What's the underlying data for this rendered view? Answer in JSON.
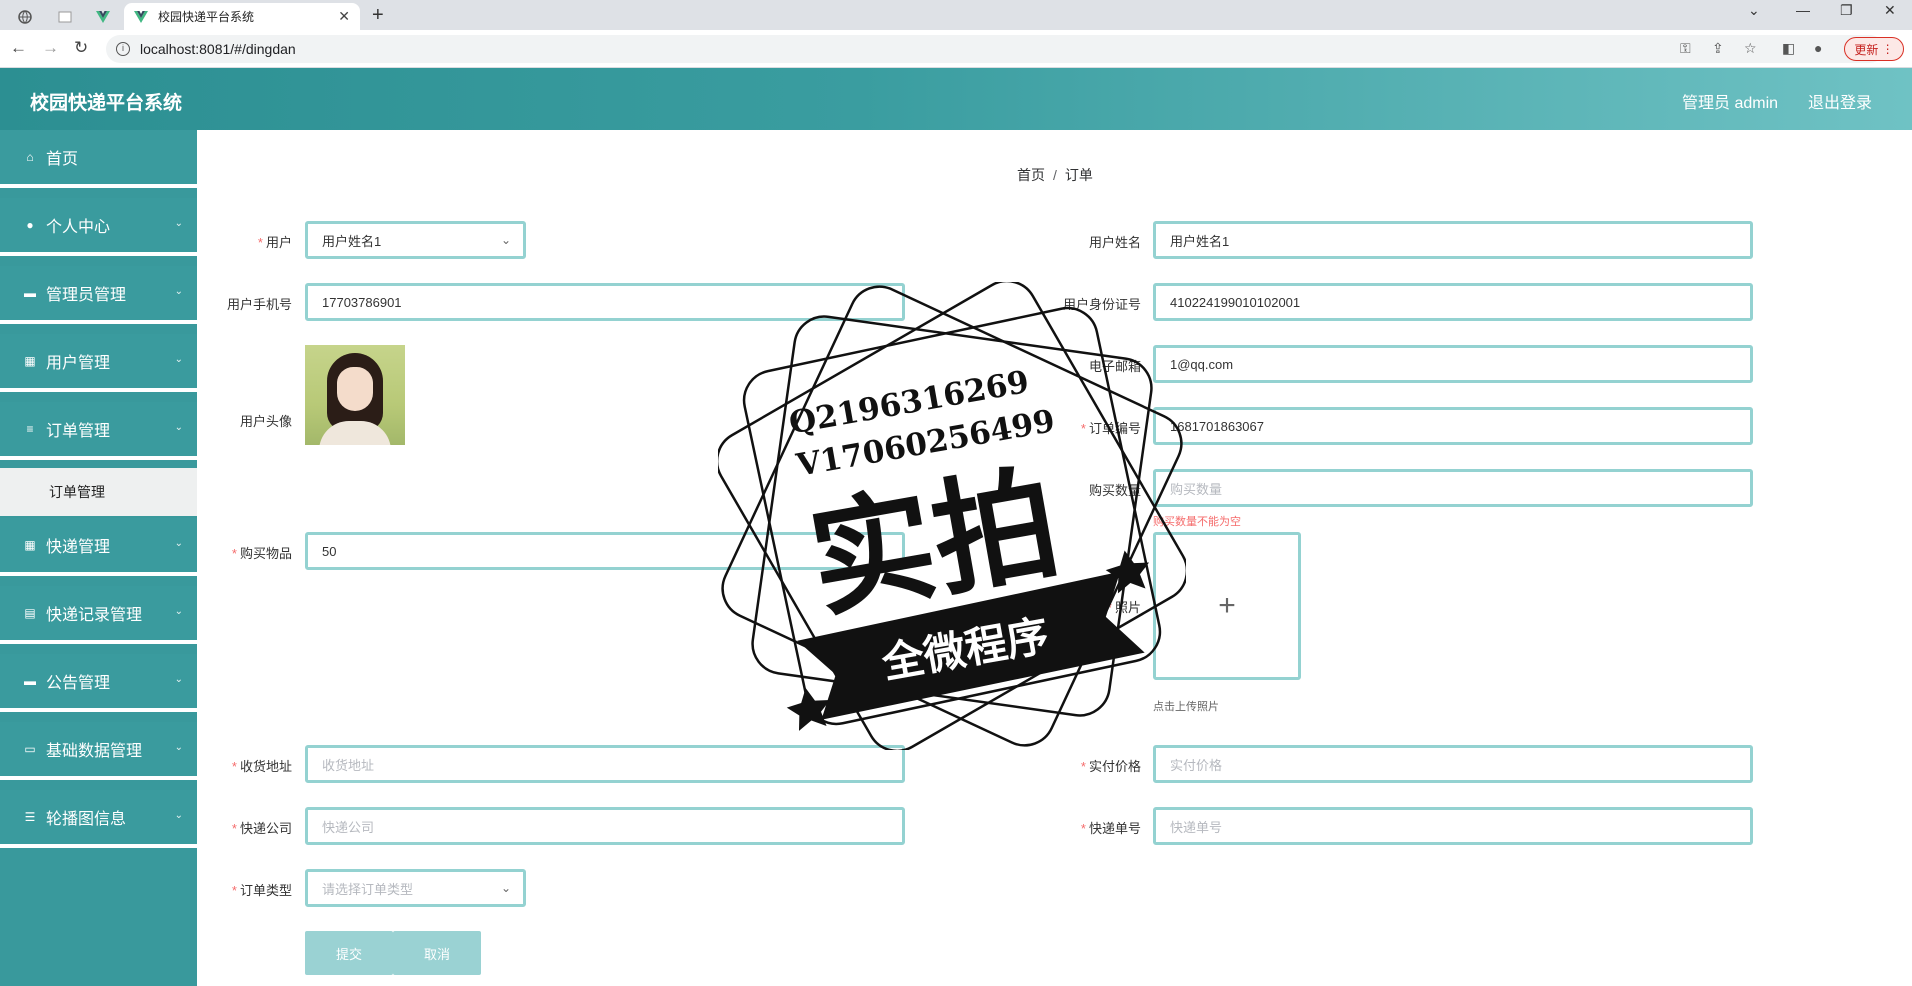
{
  "browser": {
    "tab_title": "校园快递平台系统",
    "url": "localhost:8081/#/dingdan",
    "update_label": "更新"
  },
  "header": {
    "app_title": "校园快递平台系统",
    "admin_label": "管理员 admin",
    "logout_label": "退出登录"
  },
  "sidebar": {
    "items": [
      {
        "label": "首页",
        "icon": "home-icon"
      },
      {
        "label": "个人中心",
        "icon": "user-icon"
      },
      {
        "label": "管理员管理",
        "icon": "chat-icon"
      },
      {
        "label": "用户管理",
        "icon": "grid-icon"
      },
      {
        "label": "订单管理",
        "icon": "stack-icon"
      },
      {
        "label": "快递管理",
        "icon": "grid-icon"
      },
      {
        "label": "快递记录管理",
        "icon": "clipboard-icon"
      },
      {
        "label": "公告管理",
        "icon": "box-icon"
      },
      {
        "label": "基础数据管理",
        "icon": "monitor-icon"
      },
      {
        "label": "轮播图信息",
        "icon": "sliders-icon"
      }
    ],
    "submenu": {
      "label": "订单管理"
    }
  },
  "breadcrumb": {
    "home": "首页",
    "sep": "/",
    "current": "订单"
  },
  "form": {
    "user": {
      "label": "用户",
      "value": "用户姓名1"
    },
    "user_name": {
      "label": "用户姓名",
      "value": "用户姓名1"
    },
    "phone": {
      "label": "用户手机号",
      "value": "17703786901"
    },
    "id_card": {
      "label": "用户身份证号",
      "value": "410224199010102001"
    },
    "email": {
      "label": "电子邮箱",
      "value": "1@qq.com"
    },
    "avatar": {
      "label": "用户头像"
    },
    "order_no": {
      "label": "订单编号",
      "value": "1681701863067"
    },
    "quantity": {
      "label": "购买数量",
      "placeholder": "购买数量",
      "error": "购买数量不能为空"
    },
    "item": {
      "label": "购买物品",
      "value": "50"
    },
    "photo": {
      "label": "照片",
      "hint": "点击上传照片"
    },
    "address": {
      "label": "收货地址",
      "placeholder": "收货地址"
    },
    "price": {
      "label": "实付价格",
      "placeholder": "实付价格"
    },
    "courier": {
      "label": "快递公司",
      "placeholder": "快递公司"
    },
    "tracking": {
      "label": "快递单号",
      "placeholder": "快递单号"
    },
    "order_type": {
      "label": "订单类型",
      "placeholder": "请选择订单类型"
    },
    "submit_label": "提交",
    "cancel_label": "取消"
  },
  "watermark": {
    "line1": "Q2196316269",
    "line2": "V17060256499",
    "big": "实拍",
    "banner": "全微程序"
  }
}
